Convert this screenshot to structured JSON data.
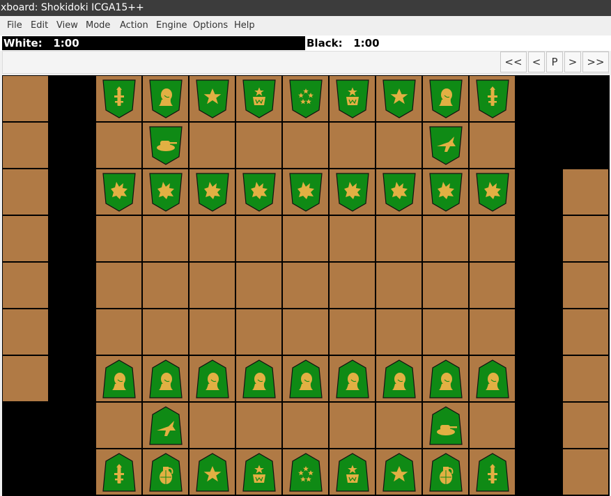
{
  "window": {
    "title": "xboard: Shokidoki ICGA15++"
  },
  "menu": [
    "File",
    "Edit",
    "View",
    "Mode",
    "Action",
    "Engine",
    "Options",
    "Help"
  ],
  "clocks": {
    "white": "White:   1:00",
    "black": "Black:   1:00"
  },
  "message": "",
  "nav": {
    "first": "<<",
    "back": "<",
    "pause": "P",
    "forward": ">",
    "last": ">>"
  },
  "colors": {
    "square": "#b07a45",
    "piece_fill": "#0f8a15",
    "symbol": "#e2b043",
    "background": "#000000"
  },
  "board": {
    "files": 9,
    "ranks": 9,
    "pieces": [
      {
        "rank": 0,
        "file": 0,
        "side": "black",
        "symbol": "rocket-launcher-icon"
      },
      {
        "rank": 0,
        "file": 1,
        "side": "black",
        "symbol": "soldier-head-icon"
      },
      {
        "rank": 0,
        "file": 2,
        "side": "black",
        "symbol": "one-star-icon"
      },
      {
        "rank": 0,
        "file": 3,
        "side": "black",
        "symbol": "medal-star-icon"
      },
      {
        "rank": 0,
        "file": 4,
        "side": "black",
        "symbol": "five-stars-icon"
      },
      {
        "rank": 0,
        "file": 5,
        "side": "black",
        "symbol": "medal-star-icon"
      },
      {
        "rank": 0,
        "file": 6,
        "side": "black",
        "symbol": "one-star-icon"
      },
      {
        "rank": 0,
        "file": 7,
        "side": "black",
        "symbol": "soldier-head-icon"
      },
      {
        "rank": 0,
        "file": 8,
        "side": "black",
        "symbol": "rocket-launcher-icon"
      },
      {
        "rank": 1,
        "file": 1,
        "side": "black",
        "symbol": "tank-icon"
      },
      {
        "rank": 1,
        "file": 7,
        "side": "black",
        "symbol": "fighter-jet-icon"
      },
      {
        "rank": 2,
        "file": 0,
        "side": "black",
        "symbol": "blast-icon"
      },
      {
        "rank": 2,
        "file": 1,
        "side": "black",
        "symbol": "blast-icon"
      },
      {
        "rank": 2,
        "file": 2,
        "side": "black",
        "symbol": "blast-icon"
      },
      {
        "rank": 2,
        "file": 3,
        "side": "black",
        "symbol": "blast-icon"
      },
      {
        "rank": 2,
        "file": 4,
        "side": "black",
        "symbol": "blast-icon"
      },
      {
        "rank": 2,
        "file": 5,
        "side": "black",
        "symbol": "blast-icon"
      },
      {
        "rank": 2,
        "file": 6,
        "side": "black",
        "symbol": "blast-icon"
      },
      {
        "rank": 2,
        "file": 7,
        "side": "black",
        "symbol": "blast-icon"
      },
      {
        "rank": 2,
        "file": 8,
        "side": "black",
        "symbol": "blast-icon"
      },
      {
        "rank": 6,
        "file": 0,
        "side": "white",
        "symbol": "soldier-head-icon"
      },
      {
        "rank": 6,
        "file": 1,
        "side": "white",
        "symbol": "soldier-head-icon"
      },
      {
        "rank": 6,
        "file": 2,
        "side": "white",
        "symbol": "soldier-head-icon"
      },
      {
        "rank": 6,
        "file": 3,
        "side": "white",
        "symbol": "soldier-head-icon"
      },
      {
        "rank": 6,
        "file": 4,
        "side": "white",
        "symbol": "soldier-head-icon"
      },
      {
        "rank": 6,
        "file": 5,
        "side": "white",
        "symbol": "soldier-head-icon"
      },
      {
        "rank": 6,
        "file": 6,
        "side": "white",
        "symbol": "soldier-head-icon"
      },
      {
        "rank": 6,
        "file": 7,
        "side": "white",
        "symbol": "soldier-head-icon"
      },
      {
        "rank": 6,
        "file": 8,
        "side": "white",
        "symbol": "soldier-head-icon"
      },
      {
        "rank": 7,
        "file": 1,
        "side": "white",
        "symbol": "fighter-jet-icon"
      },
      {
        "rank": 7,
        "file": 7,
        "side": "white",
        "symbol": "tank-icon"
      },
      {
        "rank": 8,
        "file": 0,
        "side": "white",
        "symbol": "rocket-launcher-icon"
      },
      {
        "rank": 8,
        "file": 1,
        "side": "white",
        "symbol": "grenade-icon"
      },
      {
        "rank": 8,
        "file": 2,
        "side": "white",
        "symbol": "one-star-icon"
      },
      {
        "rank": 8,
        "file": 3,
        "side": "white",
        "symbol": "medal-star-icon"
      },
      {
        "rank": 8,
        "file": 4,
        "side": "white",
        "symbol": "five-stars-icon"
      },
      {
        "rank": 8,
        "file": 5,
        "side": "white",
        "symbol": "medal-star-icon"
      },
      {
        "rank": 8,
        "file": 6,
        "side": "white",
        "symbol": "one-star-icon"
      },
      {
        "rank": 8,
        "file": 7,
        "side": "white",
        "symbol": "grenade-icon"
      },
      {
        "rank": 8,
        "file": 8,
        "side": "white",
        "symbol": "rocket-launcher-icon"
      }
    ],
    "holdings": {
      "left_squares": 7,
      "right_squares": 7
    }
  }
}
